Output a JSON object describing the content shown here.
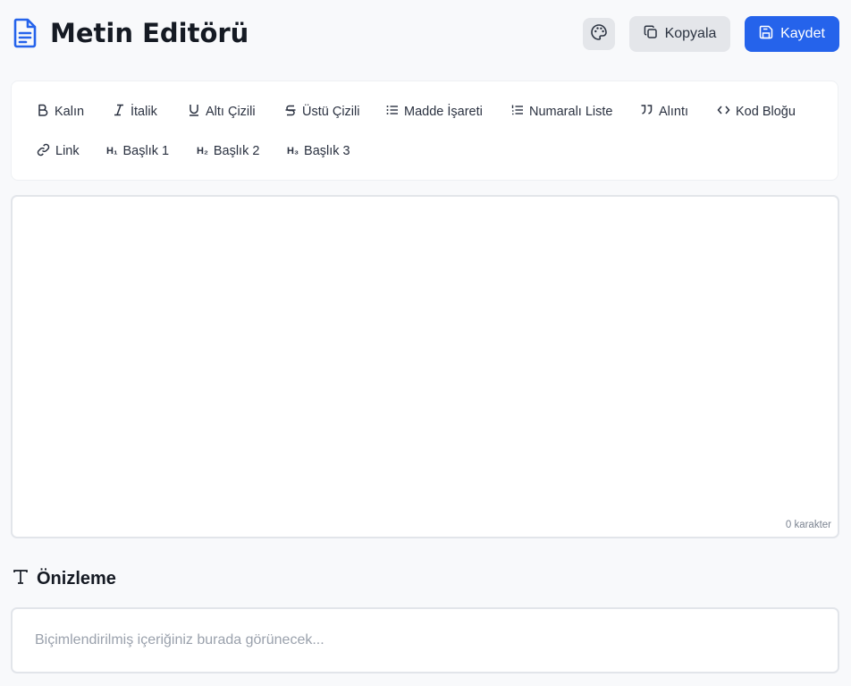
{
  "header": {
    "title": "Metin Editörü",
    "copy_label": "Kopyala",
    "save_label": "Kaydet"
  },
  "toolbar": {
    "bold": "Kalın",
    "italic": "İtalik",
    "underline": "Altı Çizili",
    "strike": "Üstü Çizili",
    "bullet": "Madde İşareti",
    "numbered": "Numaralı Liste",
    "quote": "Alıntı",
    "code": "Kod Bloğu",
    "link": "Link",
    "h1": "Başlık 1",
    "h2": "Başlık 2",
    "h3": "Başlık 3",
    "h1_glyph": "H₁",
    "h2_glyph": "H₂",
    "h3_glyph": "H₃"
  },
  "editor": {
    "counter": "0 karakter"
  },
  "preview": {
    "title": "Önizleme",
    "placeholder": "Biçimlendirilmiş içeriğiniz burada görünecek..."
  },
  "colors": {
    "accent": "#2563eb",
    "background": "#f8f9fb",
    "panel": "#ffffff"
  }
}
